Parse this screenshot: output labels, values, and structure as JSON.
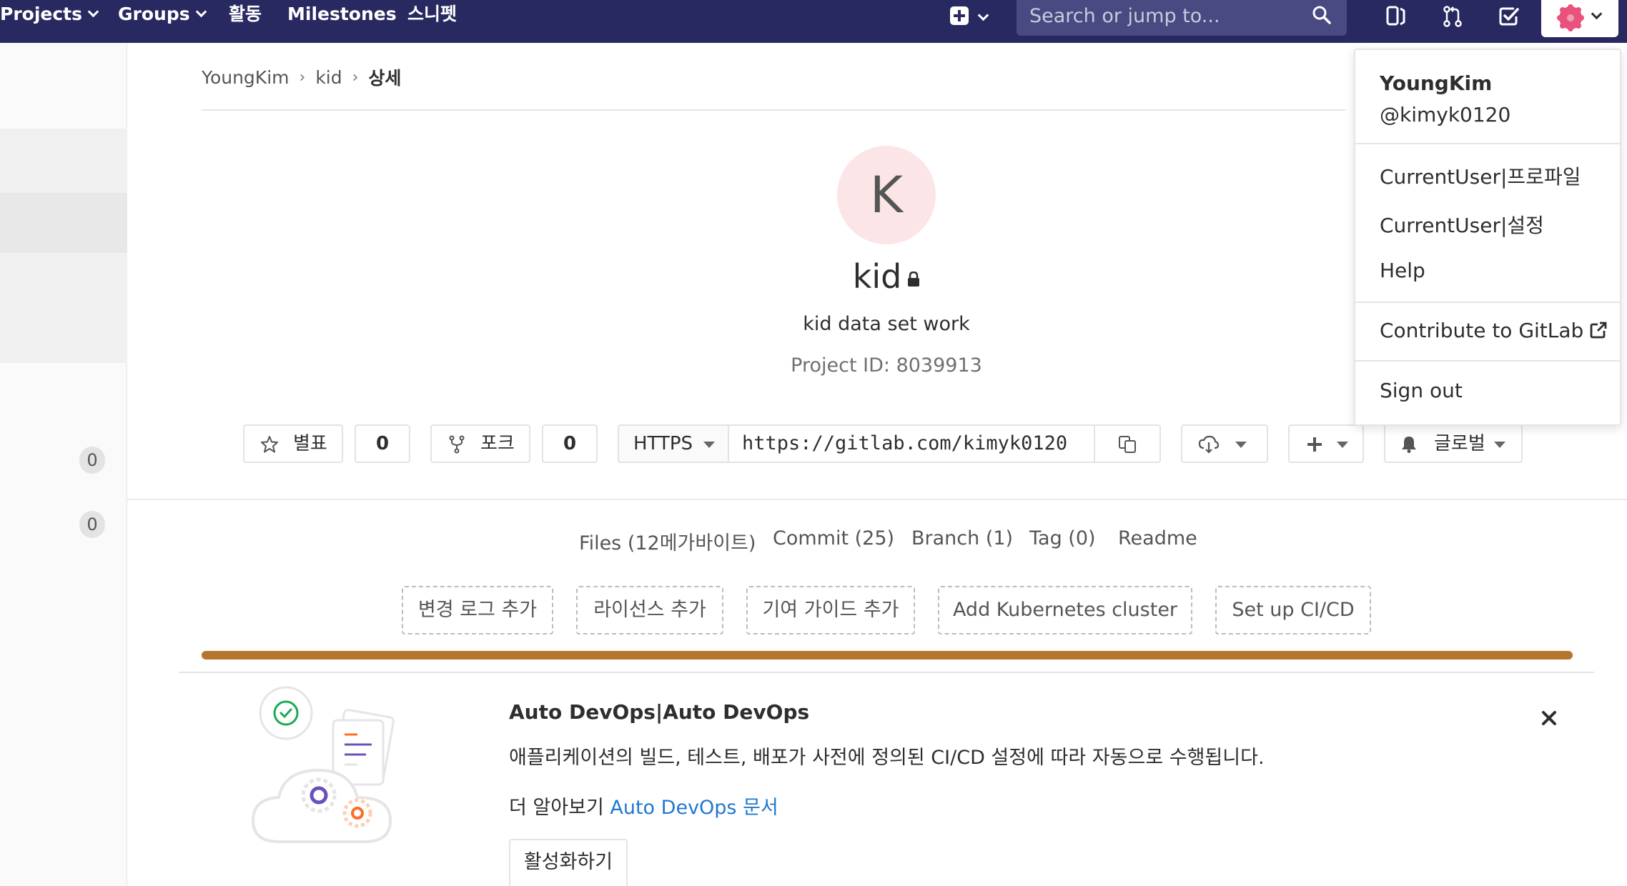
{
  "nav": {
    "projects_label": "Projects",
    "groups_label": "Groups",
    "activity_label": "활동",
    "milestones_label": "Milestones",
    "snippets_label": "스니펫",
    "search_placeholder": "Search or jump to..."
  },
  "sidebar": {
    "count_1": "0",
    "count_2": "0"
  },
  "breadcrumb": {
    "items": [
      "YoungKim",
      "kid",
      "상세"
    ]
  },
  "project": {
    "avatar_letter": "K",
    "name": "kid",
    "description": "kid data set work",
    "id_text": "Project ID: 8039913"
  },
  "actions": {
    "star_label": "별표",
    "star_count": "0",
    "fork_label": "포크",
    "fork_count": "0",
    "clone_protocol": "HTTPS",
    "clone_url": "https://gitlab.com/kimyk0120",
    "notification_label": "글로벌"
  },
  "stats": {
    "files": "Files (12메가바이트)",
    "commits": "Commit (25)",
    "branches": "Branch (1)",
    "tags": "Tag (0)",
    "readme": "Readme"
  },
  "add_buttons": {
    "changelog": "변경 로그 추가",
    "license": "라이선스 추가",
    "contributing": "기여 가이드 추가",
    "kubernetes": "Add Kubernetes cluster",
    "cicd": "Set up CI/CD"
  },
  "banner": {
    "title": "Auto DevOps|Auto DevOps",
    "text": "애플리케이션의 빌드, 테스트, 배포가 사전에 정의된 CI/CD 설정에 따라 자동으로 수행됩니다.",
    "learn_prefix": "더 알아보기",
    "learn_link": "Auto DevOps 문서",
    "enable_label": "활성화하기"
  },
  "user_menu": {
    "name": "YoungKim",
    "username": "@kimyk0120",
    "profile": "CurrentUser|프로파일",
    "settings": "CurrentUser|설정",
    "help": "Help",
    "contribute": "Contribute to GitLab",
    "sign_out": "Sign out"
  },
  "colors": {
    "navbar": "#292961",
    "search_bg": "#4a4a82",
    "link": "#1f78d1",
    "progress": "#b5752b",
    "avatar_bg": "#fbe5e6",
    "identicon": "#e8527c"
  },
  "icons": {
    "plus": "plus-icon",
    "search": "search-icon",
    "issues": "issues-icon",
    "merge_requests": "merge-request-icon",
    "todos": "todo-icon",
    "star": "star-icon",
    "fork": "fork-icon",
    "copy": "copy-icon",
    "download": "download-icon",
    "bell": "bell-icon",
    "lock": "lock-icon",
    "close": "close-icon",
    "external_link": "external-link-icon"
  }
}
